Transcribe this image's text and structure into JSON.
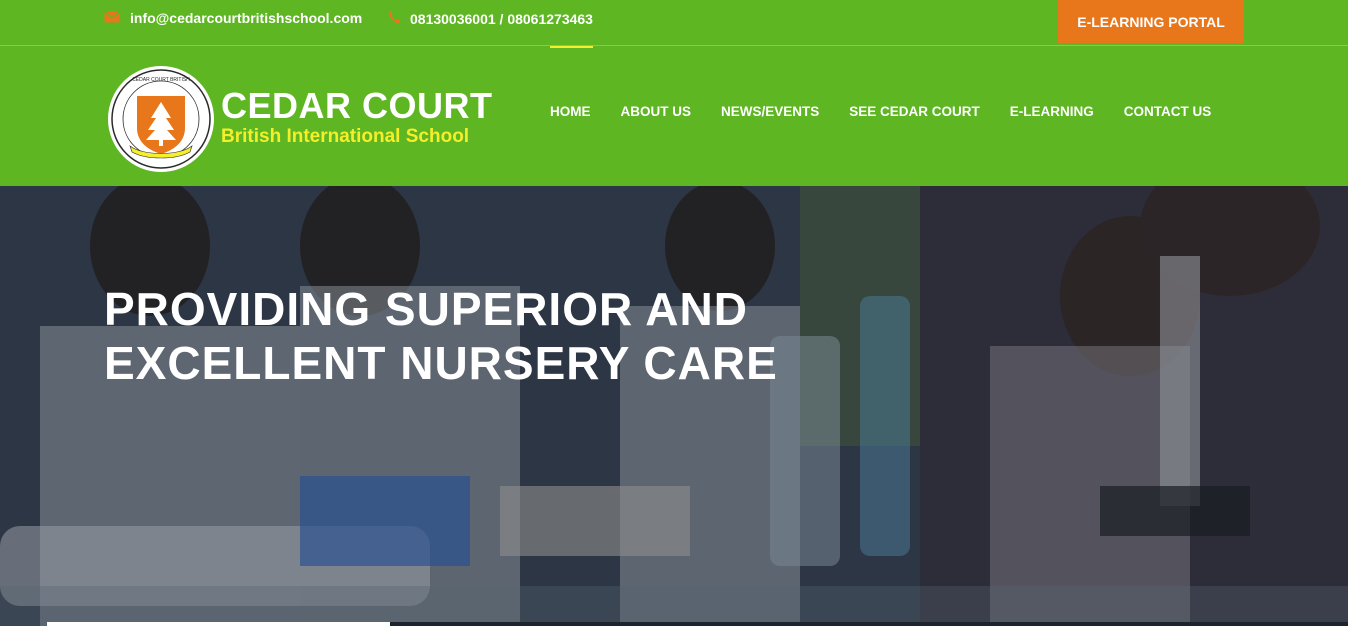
{
  "topbar": {
    "email": "info@cedarcourtbritishschool.com",
    "phone": "08130036001 / 08061273463",
    "portal_label": "E-LEARNING PORTAL",
    "email_icon": "envelope-icon",
    "phone_icon": "phone-icon",
    "accent_color": "#e8761b"
  },
  "brand": {
    "name": "CEDAR COURT",
    "subtitle": "British International School",
    "logo_ring_text": "CEDAR COURT BRITISH INTERNATIONAL SCHOOL",
    "logo_icon": "cedar-tree-icon"
  },
  "nav": {
    "items": [
      {
        "label": "HOME"
      },
      {
        "label": "ABOUT US"
      },
      {
        "label": "NEWS/EVENTS"
      },
      {
        "label": "SEE CEDAR COURT"
      },
      {
        "label": "E-LEARNING"
      },
      {
        "label": "CONTACT US"
      }
    ],
    "active": "HOME",
    "background_color": "#5eb623",
    "active_color": "#f5ee2a"
  },
  "hero": {
    "line1": "PROVIDING SUPERIOR AND",
    "line2": "EXCELLENT NURSERY CARE"
  }
}
